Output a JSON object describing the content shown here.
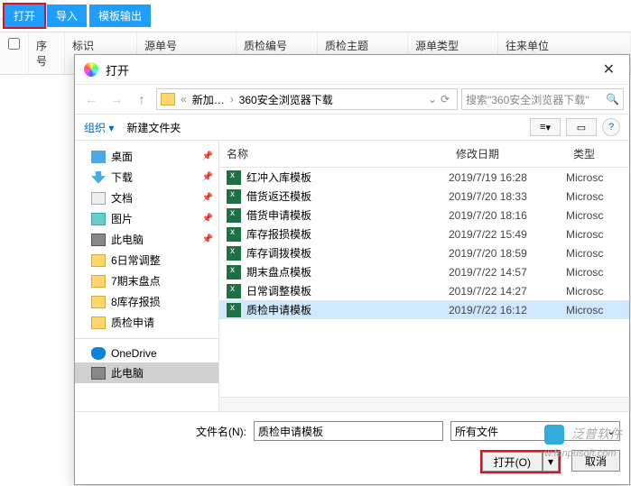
{
  "toolbar": {
    "open": "打开",
    "import": "导入",
    "tpl_out": "模板输出"
  },
  "grid": {
    "seq": "序号",
    "mark": "标识",
    "src_no": "源单号",
    "qc_no": "质检编号",
    "qc_subj": "质检主题",
    "src_type": "源单类型",
    "unit": "往来单位"
  },
  "dialog": {
    "title": "打开",
    "crumb_a": "新加…",
    "crumb_b": "360安全浏览器下载",
    "search_ph": "搜索\"360安全浏览器下载\"",
    "organize": "组织",
    "new_folder": "新建文件夹",
    "fh_name": "名称",
    "fh_date": "修改日期",
    "fh_type": "类型",
    "fname_label": "文件名(N):",
    "fname_value": "质检申请模板",
    "filter": "所有文件",
    "open_btn": "打开(O)",
    "cancel_btn": "取消",
    "view_mode": "≡"
  },
  "tree": [
    {
      "ico": "desktop",
      "label": "桌面",
      "pin": true
    },
    {
      "ico": "dl",
      "label": "下载",
      "pin": true
    },
    {
      "ico": "doc",
      "label": "文档",
      "pin": true
    },
    {
      "ico": "pic",
      "label": "图片",
      "pin": true
    },
    {
      "ico": "pc",
      "label": "此电脑",
      "pin": true
    },
    {
      "ico": "folder",
      "label": "6日常调整",
      "pin": false
    },
    {
      "ico": "folder",
      "label": "7期末盘点",
      "pin": false
    },
    {
      "ico": "folder",
      "label": "8库存报损",
      "pin": false
    },
    {
      "ico": "folder",
      "label": "质检申请",
      "pin": false
    }
  ],
  "tree2": [
    {
      "ico": "cloud",
      "label": "OneDrive"
    },
    {
      "ico": "pc",
      "label": "此电脑",
      "sel": true
    }
  ],
  "files": [
    {
      "name": "红冲入库模板",
      "date": "2019/7/19 16:28",
      "type": "Microsc"
    },
    {
      "name": "借货返还模板",
      "date": "2019/7/20 18:33",
      "type": "Microsc"
    },
    {
      "name": "借货申请模板",
      "date": "2019/7/20 18:16",
      "type": "Microsc"
    },
    {
      "name": "库存报损模板",
      "date": "2019/7/22 15:49",
      "type": "Microsc"
    },
    {
      "name": "库存调拨模板",
      "date": "2019/7/20 18:59",
      "type": "Microsc"
    },
    {
      "name": "期末盘点模板",
      "date": "2019/7/22 14:57",
      "type": "Microsc"
    },
    {
      "name": "日常调整模板",
      "date": "2019/7/22 14:27",
      "type": "Microsc"
    },
    {
      "name": "质检申请模板",
      "date": "2019/7/22 16:12",
      "type": "Microsc",
      "sel": true
    }
  ],
  "watermark": {
    "brand": "泛普软件",
    "url": "w.fanpusoft.com"
  }
}
